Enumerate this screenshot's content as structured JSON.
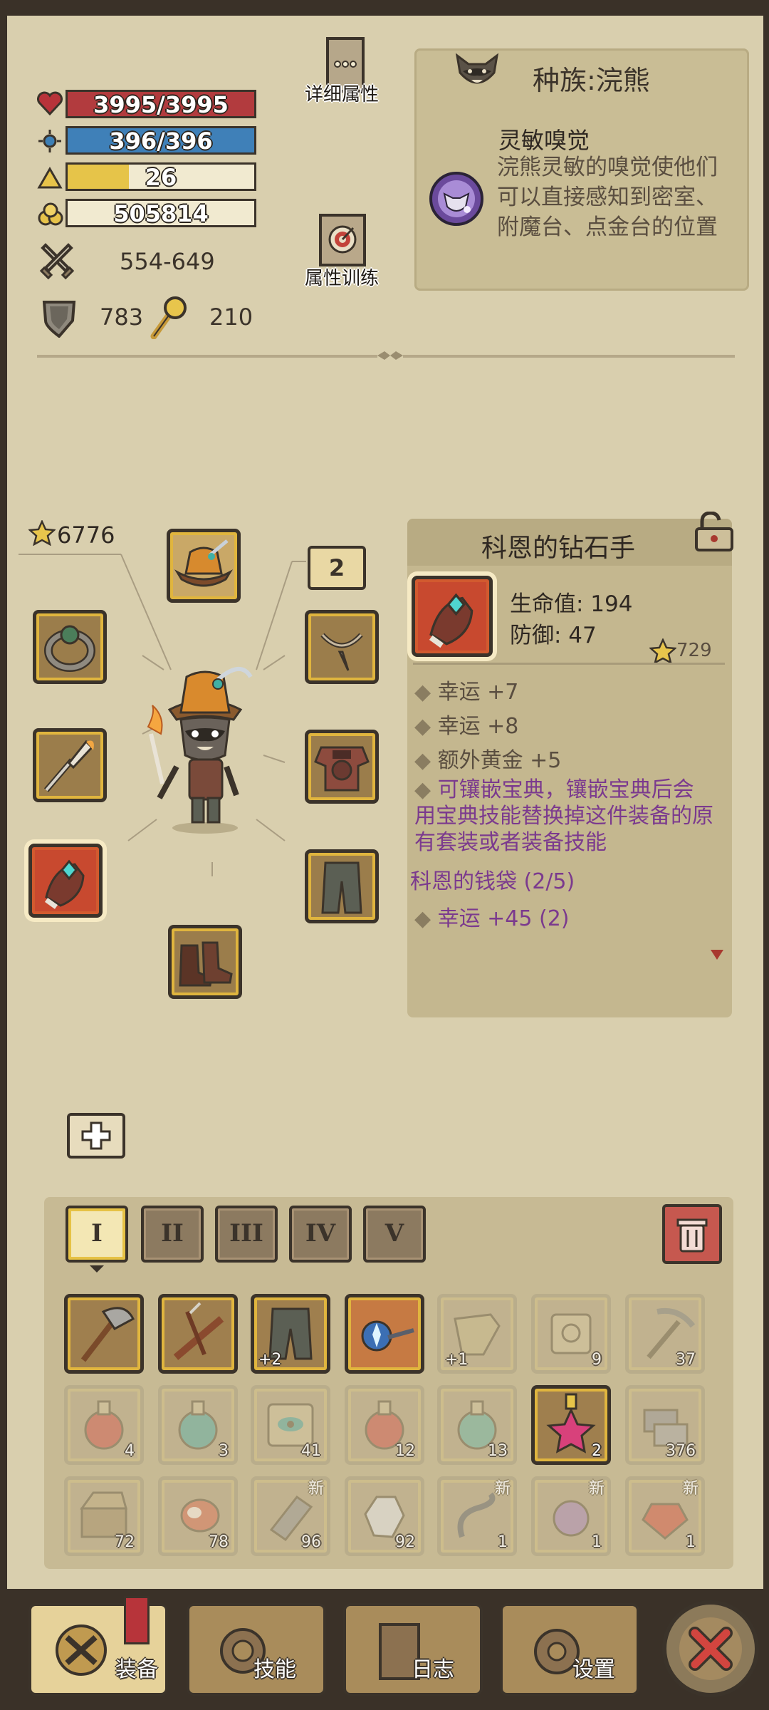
{
  "stats": {
    "hp": "3995/3995",
    "mp": "396/396",
    "level": "26",
    "level_progress": 0.33,
    "gold": "505814",
    "attack": "554-649",
    "defense": "783",
    "luck": "210"
  },
  "buttons": {
    "detail_attrs": "详细属性",
    "train_attrs": "属性训练"
  },
  "race": {
    "title": "种族:浣熊",
    "trait_name": "灵敏嗅觉",
    "trait_desc": "浣熊灵敏的嗅觉使他们可以直接感知到密室、附魔台、点金台的位置"
  },
  "equipment": {
    "score": "6776",
    "bonus_slot": "2"
  },
  "item": {
    "name": "科恩的钻石手",
    "stat1": "生命值: 194",
    "stat2": "防御: 47",
    "score": "729",
    "affixes": [
      "幸运 +7",
      "幸运 +8",
      "额外黄金 +5"
    ],
    "socket_note": "可镶嵌宝典，镶嵌宝典后会用宝典技能替换掉这件装备的原有套装或者装备技能",
    "set_name": "科恩的钱袋 (2/5)",
    "set_bonus": "幸运 +45 (2)"
  },
  "inventory": {
    "tabs": [
      "I",
      "II",
      "III",
      "IV",
      "V"
    ],
    "row1": [
      {
        "name": "axe",
        "count": ""
      },
      {
        "name": "crossbow",
        "count": ""
      },
      {
        "name": "pants",
        "count": "+2"
      },
      {
        "name": "magic-staff",
        "count": ""
      },
      {
        "name": "mask",
        "count": "+1"
      },
      {
        "name": "scroll",
        "count": "9"
      },
      {
        "name": "pickaxe",
        "count": "37"
      }
    ],
    "row2": [
      {
        "name": "red-potion",
        "count": "4"
      },
      {
        "name": "teal-potion",
        "count": "3"
      },
      {
        "name": "eye-scroll",
        "count": "41"
      },
      {
        "name": "red-potion-2",
        "count": "12"
      },
      {
        "name": "green-potion",
        "count": "13"
      },
      {
        "name": "star-potion",
        "count": "2"
      },
      {
        "name": "stone",
        "count": "376"
      }
    ],
    "row3": [
      {
        "name": "chest",
        "count": "72"
      },
      {
        "name": "meat",
        "count": "78"
      },
      {
        "name": "rune",
        "count": "96"
      },
      {
        "name": "crystal",
        "count": "92"
      },
      {
        "name": "hook",
        "count": "1"
      },
      {
        "name": "orb",
        "count": "1"
      },
      {
        "name": "gem",
        "count": "1"
      }
    ],
    "new_label": "新"
  },
  "nav": {
    "equip": "装备",
    "skills": "技能",
    "log": "日志",
    "settings": "设置"
  }
}
